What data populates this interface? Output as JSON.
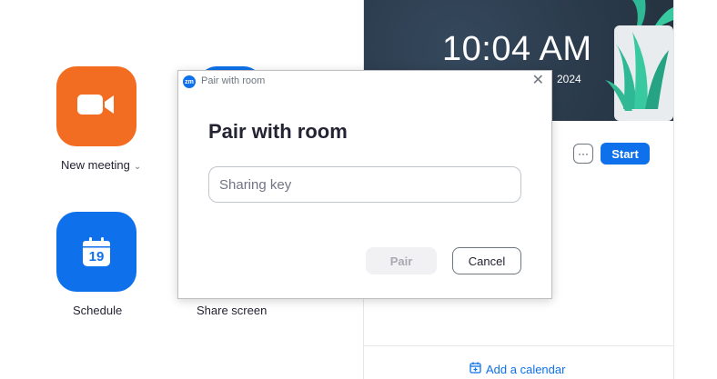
{
  "home": {
    "new_meeting": {
      "label": "New meeting",
      "chevron": "⌄",
      "icon": "video-camera-icon",
      "color": "#f26d21"
    },
    "schedule": {
      "label": "Schedule",
      "icon": "calendar-icon",
      "calendar_day": "19",
      "color": "#0e71eb"
    },
    "share_screen": {
      "label": "Share screen"
    }
  },
  "right_panel": {
    "clock": "10:04 AM",
    "date_suffix": "2024",
    "more_label": "···",
    "start_label": "Start",
    "add_calendar_label": "Add a calendar"
  },
  "dialog": {
    "window_title": "Pair with room",
    "logo_text": "zm",
    "heading": "Pair with room",
    "input_placeholder": "Sharing key",
    "input_value": "",
    "pair_label": "Pair",
    "cancel_label": "Cancel",
    "close_glyph": "✕"
  },
  "colors": {
    "accent": "#0e71eb",
    "orange": "#f26d21",
    "banner": "#2c3d4f"
  }
}
